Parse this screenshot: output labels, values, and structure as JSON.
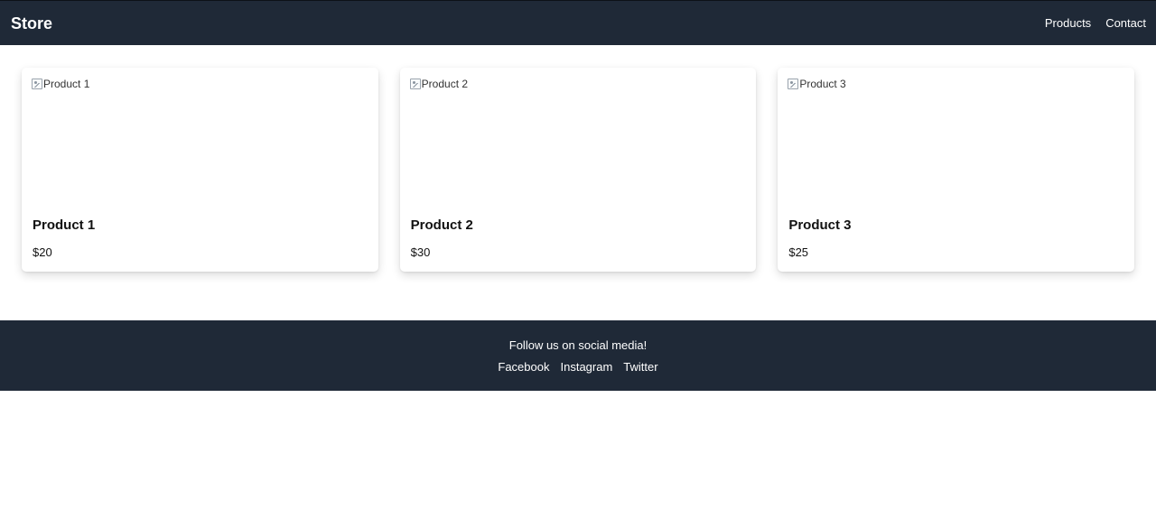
{
  "header": {
    "brand": "Store",
    "nav": [
      {
        "label": "Products"
      },
      {
        "label": "Contact"
      }
    ]
  },
  "products": [
    {
      "image_alt": "Product 1",
      "title": "Product 1",
      "price": "$20"
    },
    {
      "image_alt": "Product 2",
      "title": "Product 2",
      "price": "$30"
    },
    {
      "image_alt": "Product 3",
      "title": "Product 3",
      "price": "$25"
    }
  ],
  "footer": {
    "text": "Follow us on social media!",
    "links": [
      {
        "label": "Facebook"
      },
      {
        "label": "Instagram"
      },
      {
        "label": "Twitter"
      }
    ]
  },
  "colors": {
    "header_bg": "#1f2937",
    "footer_bg": "#1f2937",
    "page_bg": "#ffffff",
    "text_light": "#ffffff",
    "text_dark": "#111111"
  },
  "icons": {
    "broken_image": "broken-image-icon"
  }
}
